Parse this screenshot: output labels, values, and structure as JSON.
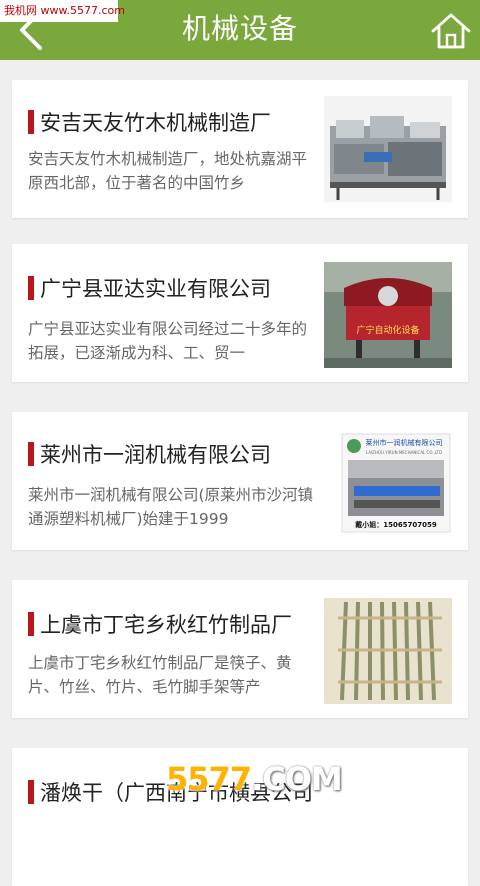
{
  "watermark": "我机网 www.5577.com",
  "header": {
    "title": "机械设备"
  },
  "items": [
    {
      "name": "安吉天友竹木机械制造厂",
      "desc": "安吉天友竹木机械制造厂，地处杭嘉湖平原西北部，位于著名的中国竹乡"
    },
    {
      "name": "广宁县亚达实业有限公司",
      "desc": "广宁县亚达实业有限公司经过二十多年的拓展，已逐渐成为科、工、贸一",
      "thumb_caption": "广宁自动化设备"
    },
    {
      "name": "莱州市一润机械有限公司",
      "desc": "莱州市一润机械有限公司(原莱州市沙河镇通源塑料机械厂)始建于1999",
      "thumb_title": "莱州市一润机械有限公司",
      "thumb_subtitle": "LAIZHOU YIRUN MECHANICAL CO.,LTD",
      "thumb_contact": "戴小姐：15065707059"
    },
    {
      "name": "上虞市丁宅乡秋红竹制品厂",
      "desc": "上虞市丁宅乡秋红竹制品厂是筷子、黄片、竹丝、竹片、毛竹脚手架等产"
    },
    {
      "name": "潘焕干（广西南宁市横县公司",
      "desc": ""
    }
  ],
  "logo": {
    "digits": "5577",
    "suffix": ".COM"
  }
}
